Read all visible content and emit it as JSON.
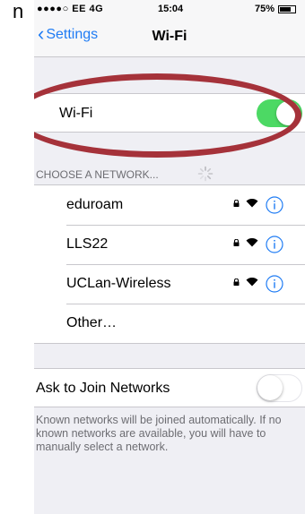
{
  "fragment": {
    "text": "n"
  },
  "status_bar": {
    "carrier": "●●●●○ EE  4G",
    "time": "15:04",
    "battery_text": "75%",
    "battery_level": 0.75
  },
  "nav": {
    "back_label": "Settings",
    "title": "Wi-Fi"
  },
  "wifi_toggle": {
    "label": "Wi-Fi",
    "state": "on",
    "color": "#4cd964"
  },
  "section": {
    "header": "CHOOSE A NETWORK..."
  },
  "networks": [
    {
      "name": "eduroam",
      "secured": true
    },
    {
      "name": "LLS22",
      "secured": true
    },
    {
      "name": "UCLan-Wireless",
      "secured": true
    },
    {
      "name": "Other…",
      "secured": false
    }
  ],
  "ask_to_join": {
    "label": "Ask to Join Networks",
    "state": "off",
    "footer": "Known networks will be joined automatically. If no known networks are available, you will have to manually select a network."
  },
  "annotation": {
    "shape": "ellipse",
    "color": "#a5323a"
  },
  "accent_color": "#1f7cf4"
}
